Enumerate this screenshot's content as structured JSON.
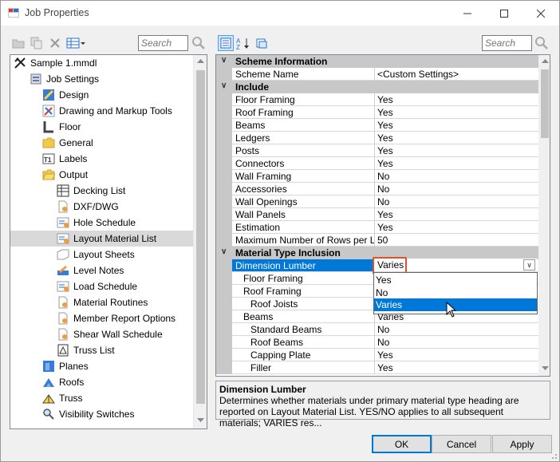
{
  "window": {
    "title": "Job Properties"
  },
  "left_toolbar": {
    "search_placeholder": "Search"
  },
  "right_toolbar": {
    "search_placeholder": "Search"
  },
  "tree": {
    "items": [
      {
        "label": "Sample 1.mmdl",
        "icon": "project-icon"
      },
      {
        "label": "Job Settings",
        "icon": "settings-icon"
      },
      {
        "label": "Design",
        "icon": "design-icon"
      },
      {
        "label": "Drawing and Markup Tools",
        "icon": "drawing-tools-icon"
      },
      {
        "label": "Floor",
        "icon": "floor-icon"
      },
      {
        "label": "General",
        "icon": "folder-icon"
      },
      {
        "label": "Labels",
        "icon": "labels-icon"
      },
      {
        "label": "Output",
        "icon": "folder-open-icon"
      },
      {
        "label": "Decking List",
        "icon": "list-icon"
      },
      {
        "label": "DXF/DWG",
        "icon": "dxf-icon"
      },
      {
        "label": "Hole Schedule",
        "icon": "report-icon"
      },
      {
        "label": "Layout Material List",
        "icon": "report-icon"
      },
      {
        "label": "Layout Sheets",
        "icon": "sheets-icon"
      },
      {
        "label": "Level Notes",
        "icon": "notes-icon"
      },
      {
        "label": "Load Schedule",
        "icon": "report-icon"
      },
      {
        "label": "Material Routines",
        "icon": "report-icon"
      },
      {
        "label": "Member Report Options",
        "icon": "report-icon"
      },
      {
        "label": "Shear Wall Schedule",
        "icon": "report-icon"
      },
      {
        "label": "Truss List",
        "icon": "list-icon"
      },
      {
        "label": "Planes",
        "icon": "planes-icon"
      },
      {
        "label": "Roofs",
        "icon": "roofs-icon"
      },
      {
        "label": "Truss",
        "icon": "truss-icon"
      },
      {
        "label": "Visibility Switches",
        "icon": "visibility-icon"
      }
    ]
  },
  "grid": {
    "rows": [
      {
        "kind": "category",
        "label": "Scheme Information"
      },
      {
        "kind": "prop",
        "name": "Scheme Name",
        "value": "<Custom Settings>",
        "indent": 0
      },
      {
        "kind": "category",
        "label": "Include"
      },
      {
        "kind": "prop",
        "name": "Floor Framing",
        "value": "Yes",
        "indent": 0
      },
      {
        "kind": "prop",
        "name": "Roof Framing",
        "value": "Yes",
        "indent": 0
      },
      {
        "kind": "prop",
        "name": "Beams",
        "value": "Yes",
        "indent": 0
      },
      {
        "kind": "prop",
        "name": "Ledgers",
        "value": "Yes",
        "indent": 0
      },
      {
        "kind": "prop",
        "name": "Posts",
        "value": "Yes",
        "indent": 0
      },
      {
        "kind": "prop",
        "name": "Connectors",
        "value": "Yes",
        "indent": 0
      },
      {
        "kind": "prop",
        "name": "Wall Framing",
        "value": "No",
        "indent": 0
      },
      {
        "kind": "prop",
        "name": "Accessories",
        "value": "No",
        "indent": 0
      },
      {
        "kind": "prop",
        "name": "Wall Openings",
        "value": "No",
        "indent": 0
      },
      {
        "kind": "prop",
        "name": "Wall Panels",
        "value": "Yes",
        "indent": 0
      },
      {
        "kind": "prop",
        "name": "Estimation",
        "value": "Yes",
        "indent": 0
      },
      {
        "kind": "prop",
        "name": "Maximum Number of Rows per List",
        "value": "50",
        "indent": 0
      },
      {
        "kind": "category",
        "label": "Material Type Inclusion"
      },
      {
        "kind": "prop",
        "name": "Dimension Lumber",
        "value": "Varies",
        "indent": 0,
        "selected": true
      },
      {
        "kind": "prop",
        "name": "Floor Framing",
        "value": "",
        "indent": 1
      },
      {
        "kind": "prop",
        "name": "Roof Framing",
        "value": "",
        "indent": 1
      },
      {
        "kind": "prop",
        "name": "Roof Joists",
        "value": "",
        "indent": 2
      },
      {
        "kind": "prop",
        "name": "Beams",
        "value": "Varies",
        "indent": 1
      },
      {
        "kind": "prop",
        "name": "Standard Beams",
        "value": "No",
        "indent": 2
      },
      {
        "kind": "prop",
        "name": "Roof Beams",
        "value": "No",
        "indent": 2
      },
      {
        "kind": "prop",
        "name": "Capping Plate",
        "value": "Yes",
        "indent": 2
      },
      {
        "kind": "prop",
        "name": "Filler",
        "value": "Yes",
        "indent": 2
      }
    ]
  },
  "dropdown": {
    "current": "Varies",
    "options": [
      "Yes",
      "No",
      "Varies"
    ],
    "highlighted": "Varies"
  },
  "description": {
    "title": "Dimension Lumber",
    "text": "Determines whether materials under primary material type heading are reported on Layout Material List. YES/NO applies to all subsequent materials; VARIES res..."
  },
  "buttons": {
    "ok": "OK",
    "cancel": "Cancel",
    "apply": "Apply"
  },
  "colors": {
    "selection": "#0078d7",
    "highlight_border": "#d9532c",
    "category_bg": "#c8c8c8"
  }
}
